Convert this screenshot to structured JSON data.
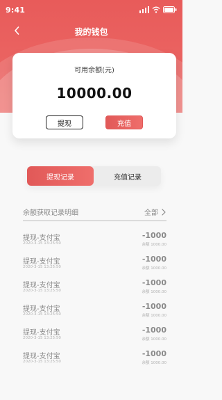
{
  "status": {
    "time": "9:41"
  },
  "nav": {
    "title": "我的钱包"
  },
  "card": {
    "label": "可用余额(元)",
    "amount": "10000.00",
    "withdraw_label": "提现",
    "recharge_label": "充值"
  },
  "tabs": [
    {
      "label": "提现记录",
      "active": true
    },
    {
      "label": "充值记录",
      "active": false
    }
  ],
  "section": {
    "title": "余额获取记录明细",
    "filter_label": "全部"
  },
  "records": [
    {
      "title": "提现-支付宝",
      "time": "2020-3-15 13:25:50",
      "amount": "-1000",
      "balance": "余额 1000.00"
    },
    {
      "title": "提现-支付宝",
      "time": "2020-3-15 13:25:50",
      "amount": "-1000",
      "balance": "余额 1000.00"
    },
    {
      "title": "提现-支付宝",
      "time": "2020-3-15 13:25:50",
      "amount": "-1000",
      "balance": "余额 1000.00"
    },
    {
      "title": "提现-支付宝",
      "time": "2020-3-15 13:25:50",
      "amount": "-1000",
      "balance": "余额 1000.00"
    },
    {
      "title": "提现-支付宝",
      "time": "2020-3-15 13:25:50",
      "amount": "-1000",
      "balance": "余额 1000.00"
    },
    {
      "title": "提现-支付宝",
      "time": "2020-3-15 13:25:50",
      "amount": "-1000",
      "balance": "余额 1000.00"
    }
  ],
  "colors": {
    "brand": "#e85b5a",
    "text_muted": "#8a8a8a"
  }
}
